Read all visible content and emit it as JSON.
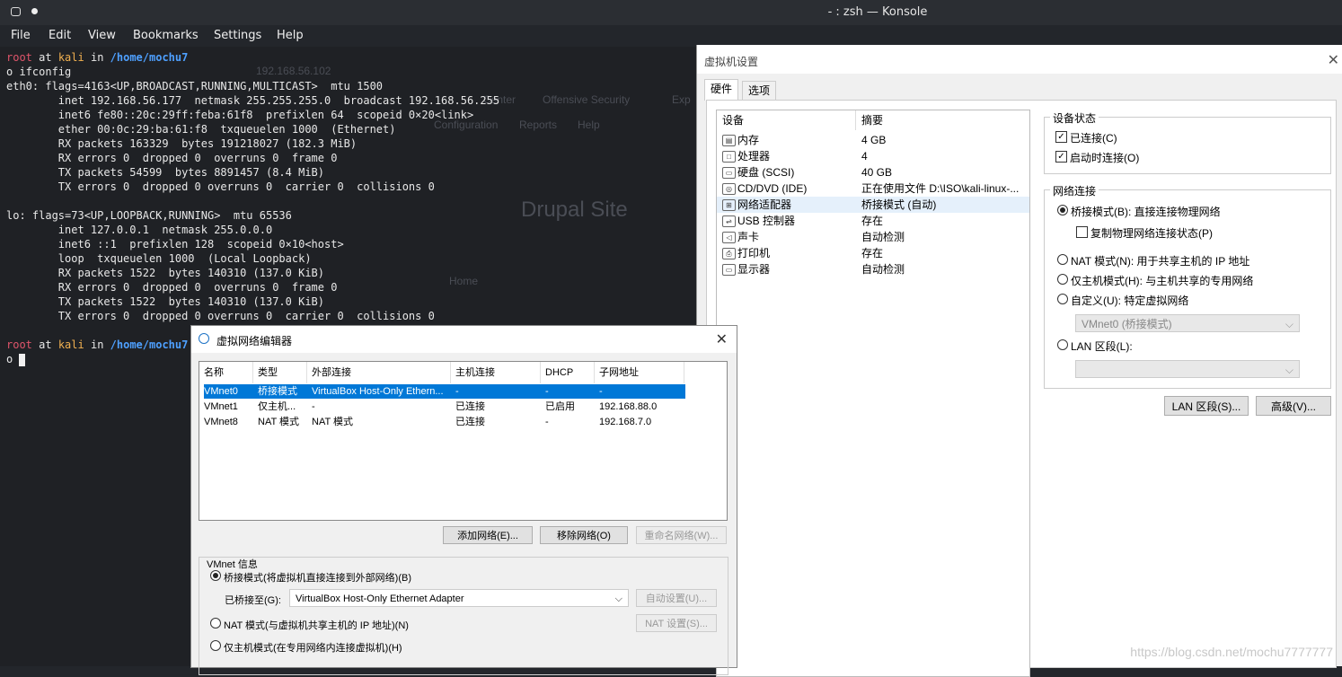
{
  "konsole": {
    "title": "- : zsh — Konsole",
    "menu": [
      "File",
      "Edit",
      "View",
      "Bookmarks",
      "Settings",
      "Help"
    ],
    "prompt": {
      "user": "root",
      "at": "at",
      "host": "kali",
      "in": "in",
      "path": "/home/mochu7"
    },
    "command": "o ifconfig",
    "output": [
      "eth0: flags=4163<UP,BROADCAST,RUNNING,MULTICAST>  mtu 1500",
      "        inet 192.168.56.177  netmask 255.255.255.0  broadcast 192.168.56.255",
      "        inet6 fe80::20c:29ff:feba:61f8  prefixlen 64  scopeid 0×20<link>",
      "        ether 00:0c:29:ba:61:f8  txqueuelen 1000  (Ethernet)",
      "        RX packets 163329  bytes 191218027 (182.3 MiB)",
      "        RX errors 0  dropped 0  overruns 0  frame 0",
      "        TX packets 54599  bytes 8891457 (8.4 MiB)",
      "        TX errors 0  dropped 0 overruns 0  carrier 0  collisions 0",
      "",
      "lo: flags=73<UP,LOOPBACK,RUNNING>  mtu 65536",
      "        inet 127.0.0.1  netmask 255.0.0.0",
      "        inet6 ::1  prefixlen 128  scopeid 0×10<host>",
      "        loop  txqueuelen 1000  (Local Loopback)",
      "        RX packets 1522  bytes 140310 (137.0 KiB)",
      "        RX errors 0  dropped 0  overruns 0  frame 0",
      "        TX packets 1522  bytes 140310 (137.0 KiB)",
      "        TX errors 0  dropped 0 overruns 0  carrier 0  collisions 0"
    ],
    "prompt2_symbol": "o",
    "ghost": {
      "ip": "192.168.56.102",
      "center": "Center",
      "offsec": "Offensive Security",
      "exploit": "Exp",
      "config": "Configuration",
      "reports": "Reports",
      "help": "Help",
      "drupal": "Drupal Site",
      "home": "Home"
    }
  },
  "vm_settings": {
    "title": "虚拟机设置",
    "tabs": [
      "硬件",
      "选项"
    ],
    "device_header": "设备",
    "summary_header": "摘要",
    "devices": [
      {
        "name": "内存",
        "summary": "4 GB",
        "icon": "memory-icon"
      },
      {
        "name": "处理器",
        "summary": "4",
        "icon": "cpu-icon"
      },
      {
        "name": "硬盘 (SCSI)",
        "summary": "40 GB",
        "icon": "harddisk-icon"
      },
      {
        "name": "CD/DVD (IDE)",
        "summary": "正在使用文件 D:\\ISO\\kali-linux-...",
        "icon": "cdrom-icon"
      },
      {
        "name": "网络适配器",
        "summary": "桥接模式 (自动)",
        "icon": "network-adapter-icon"
      },
      {
        "name": "USB 控制器",
        "summary": "存在",
        "icon": "usb-icon"
      },
      {
        "name": "声卡",
        "summary": "自动检测",
        "icon": "sound-icon"
      },
      {
        "name": "打印机",
        "summary": "存在",
        "icon": "printer-icon"
      },
      {
        "name": "显示器",
        "summary": "自动检测",
        "icon": "display-icon"
      }
    ],
    "device_status": {
      "title": "设备状态",
      "connected": "已连接(C)",
      "connect_on_start": "启动时连接(O)"
    },
    "network": {
      "title": "网络连接",
      "bridged": "桥接模式(B): 直接连接物理网络",
      "replicate": "复制物理网络连接状态(P)",
      "nat": "NAT 模式(N): 用于共享主机的 IP 地址",
      "host_only": "仅主机模式(H): 与主机共享的专用网络",
      "custom": "自定义(U): 特定虚拟网络",
      "custom_value": "VMnet0 (桥接模式)",
      "lan": "LAN 区段(L):",
      "lan_value": ""
    },
    "buttons": {
      "lan_segments": "LAN 区段(S)...",
      "advanced": "高级(V)..."
    }
  },
  "net_editor": {
    "title": "虚拟网络编辑器",
    "columns": [
      "名称",
      "类型",
      "外部连接",
      "主机连接",
      "DHCP",
      "子网地址"
    ],
    "rows": [
      [
        "VMnet0",
        "桥接模式",
        "VirtualBox Host-Only Ethern...",
        "-",
        "-",
        "-"
      ],
      [
        "VMnet1",
        "仅主机...",
        "-",
        "已连接",
        "已启用",
        "192.168.88.0"
      ],
      [
        "VMnet8",
        "NAT 模式",
        "NAT 模式",
        "已连接",
        "-",
        "192.168.7.0"
      ]
    ],
    "buttons": {
      "add": "添加网络(E)...",
      "remove": "移除网络(O)",
      "rename": "重命名网络(W)..."
    },
    "info_title": "VMnet 信息",
    "bridged": "桥接模式(将虚拟机直接连接到外部网络)(B)",
    "bridged_to_label": "已桥接至(G):",
    "bridged_to_value": "VirtualBox Host-Only Ethernet Adapter",
    "auto_settings": "自动设置(U)...",
    "nat": "NAT 模式(与虚拟机共享主机的 IP 地址)(N)",
    "nat_settings": "NAT 设置(S)...",
    "host_only": "仅主机模式(在专用网络内连接虚拟机)(H)"
  },
  "watermark": "https://blog.csdn.net/mochu7777777"
}
